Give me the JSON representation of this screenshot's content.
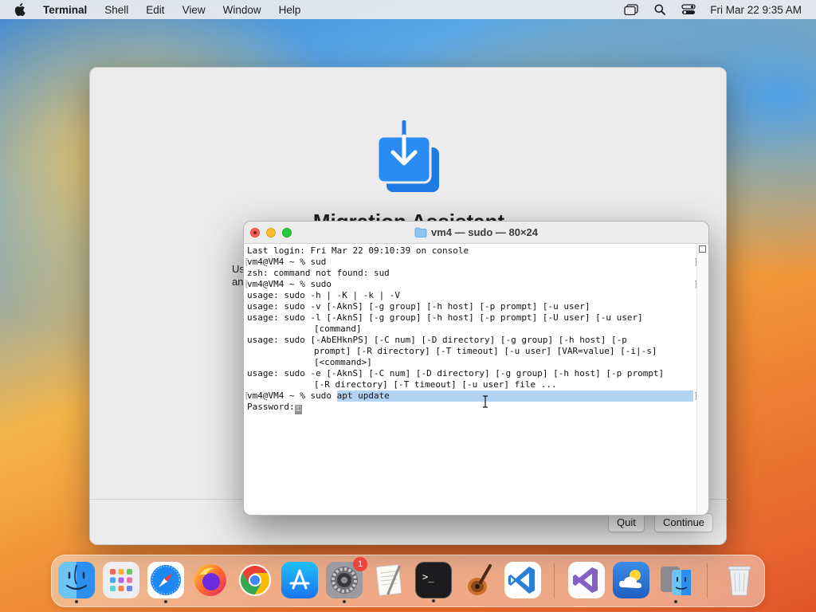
{
  "menubar": {
    "app_name": "Terminal",
    "items": [
      "Shell",
      "Edit",
      "View",
      "Window",
      "Help"
    ],
    "clock": "Fri Mar 22  9:35 AM",
    "icons": [
      "apple-icon",
      "window-switcher-icon",
      "spotlight-search-icon",
      "control-center-icon"
    ]
  },
  "migration_assistant": {
    "title": "Migration Assistant",
    "side_text_1": "Us",
    "side_text_2": "an",
    "quit_label": "Quit",
    "continue_label": "Continue",
    "icon": "migration-download-icon"
  },
  "terminal": {
    "title": "vm4 — sudo — 80×24",
    "lines": [
      "Last login: Fri Mar 22 09:10:39 on console",
      "vm4@VM4 ~ % sud",
      "zsh: command not found: sud",
      "vm4@VM4 ~ % sudo",
      "usage: sudo -h | -K | -k | -V",
      "usage: sudo -v [-AknS] [-g group] [-h host] [-p prompt] [-u user]",
      "usage: sudo -l [-AknS] [-g group] [-h host] [-p prompt] [-U user] [-u user]",
      "[command]",
      "usage: sudo [-AbEHknPS] [-C num] [-D directory] [-g group] [-h host] [-p",
      "prompt] [-R directory] [-T timeout] [-u user] [VAR=value] [-i|-s]",
      "[<command>]",
      "usage: sudo -e [-AknS] [-C num] [-D directory] [-g group] [-h host] [-p prompt]",
      "[-R directory] [-T timeout] [-u user] file ...",
      "vm4@VM4 ~ % sudo apt update",
      "Password:"
    ],
    "cursor_glyph": "⚿"
  },
  "dock": {
    "apps": [
      {
        "name": "Finder",
        "color": "#2b8ff0",
        "running": true
      },
      {
        "name": "Launchpad",
        "color": "#e9e9ef",
        "running": false
      },
      {
        "name": "Safari",
        "color": "#1e88f2",
        "running": true
      },
      {
        "name": "Firefox",
        "color": "#7b3ff0",
        "running": false
      },
      {
        "name": "Google Chrome",
        "color": "#ffffff",
        "running": false
      },
      {
        "name": "App Store",
        "color": "#1a8cf5",
        "running": false
      },
      {
        "name": "System Preferences",
        "color": "#8e8e93",
        "running": true,
        "badge": "1"
      },
      {
        "name": "TextEdit",
        "color": "#f5f5f0",
        "running": false
      },
      {
        "name": "Terminal",
        "color": "#1a1a1a",
        "running": true
      },
      {
        "name": "Instruments",
        "color": "#6a3b1a",
        "running": false
      },
      {
        "name": "Visual Studio Code",
        "color": "#2b7fd6",
        "running": false
      },
      {
        "name": "Visual Studio",
        "color": "#f7f7fb",
        "running": false
      },
      {
        "name": "Weather",
        "color": "#2a76d8",
        "running": false
      },
      {
        "name": "Migration Assistant",
        "color": "#8a8a8f",
        "running": true
      },
      {
        "name": "Trash",
        "color": "#d8dde2",
        "running": false
      }
    ]
  }
}
